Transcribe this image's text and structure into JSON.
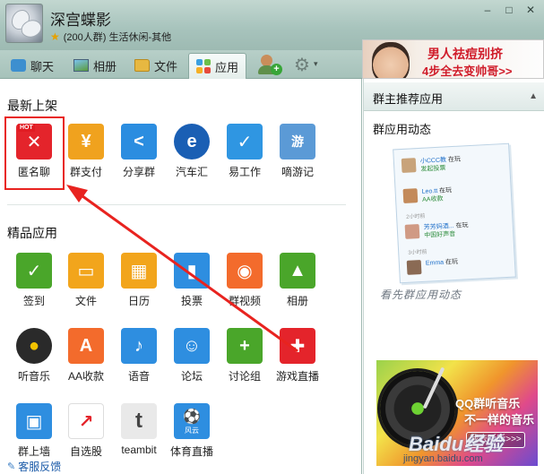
{
  "window": {
    "group_name": "深宫蝶影",
    "group_info": "(200人群) 生活休闲-其他",
    "controls": [
      "–",
      "□",
      "✕"
    ]
  },
  "tabs": [
    {
      "label": "聊天",
      "icon": "chat-icon"
    },
    {
      "label": "相册",
      "icon": "album-icon"
    },
    {
      "label": "文件",
      "icon": "folder-icon"
    },
    {
      "label": "应用",
      "icon": "apps-icon",
      "active": true
    }
  ],
  "ad_banner": {
    "line1": "男人祛痘别挤",
    "line2": "4步全去变帅哥>>"
  },
  "new_apps": {
    "title": "最新上架",
    "items": [
      {
        "label": "匿名聊",
        "color": "#e4242b",
        "glyph": "✕",
        "badge": "HOT"
      },
      {
        "label": "群支付",
        "color": "#f0a21e",
        "glyph": "¥"
      },
      {
        "label": "分享群",
        "color": "#2b8de0",
        "glyph": "<"
      },
      {
        "label": "汽车汇",
        "color": "#1a5fb4",
        "glyph": "e"
      },
      {
        "label": "易工作",
        "color": "#2f96e2",
        "glyph": "✓"
      },
      {
        "label": "嘀游记",
        "color": "#5b9ad6",
        "glyph": "游"
      }
    ]
  },
  "featured_apps": {
    "title": "精品应用",
    "rows": [
      [
        {
          "label": "签到",
          "color": "#4aa62a",
          "glyph": "✓"
        },
        {
          "label": "文件",
          "color": "#f2a51c",
          "glyph": "▭"
        },
        {
          "label": "日历",
          "color": "#f2a51c",
          "glyph": "▦"
        },
        {
          "label": "投票",
          "color": "#2e8ee0",
          "glyph": "▮"
        },
        {
          "label": "群视频",
          "color": "#f36b2c",
          "glyph": "◉"
        },
        {
          "label": "相册",
          "color": "#4aa62a",
          "glyph": "▲"
        }
      ],
      [
        {
          "label": "听音乐",
          "color": "#2a2a2a",
          "glyph": "●"
        },
        {
          "label": "AA收款",
          "color": "#f36b2c",
          "glyph": "A"
        },
        {
          "label": "语音",
          "color": "#2e8ee0",
          "glyph": "♪"
        },
        {
          "label": "论坛",
          "color": "#2e8ee0",
          "glyph": "☺"
        },
        {
          "label": "讨论组",
          "color": "#4aa62a",
          "glyph": "+"
        },
        {
          "label": "游戏直播",
          "color": "#e4242b",
          "glyph": "✚"
        }
      ],
      [
        {
          "label": "群上墙",
          "color": "#2e8ee0",
          "glyph": "▣"
        },
        {
          "label": "自选股",
          "color": "#e4242b",
          "glyph": "↗"
        },
        {
          "label": "teambit",
          "color": "#444444",
          "glyph": "t"
        },
        {
          "label": "体育直播",
          "color": "#2e8ee0",
          "glyph": "⚽",
          "badge": "风云"
        }
      ]
    ]
  },
  "status": {
    "feedback": "客服反馈"
  },
  "sidebar": {
    "recommend_title": "群主推荐应用",
    "feed_title": "群应用动态",
    "feed": [
      {
        "name": "小CCC教",
        "action": "在玩",
        "app": "发起投票"
      },
      {
        "name": "Leo.tt",
        "action": "在玩",
        "app": "AA收款"
      },
      {
        "name": "芳芳妈酒...",
        "action": "在玩",
        "app": "中国好声音"
      },
      {
        "name": "Emma",
        "action": "在玩",
        "app": ""
      }
    ],
    "feed_times": [
      "2小时前",
      "3小时前"
    ],
    "handwrite": "看先群应用动态",
    "music_ad": {
      "line1": "QQ群听音乐",
      "line2": "不一样的音乐",
      "button": "我去听听>>>"
    }
  },
  "watermark": {
    "brand": "Baidu经验",
    "url": "jingyan.baidu.com"
  }
}
